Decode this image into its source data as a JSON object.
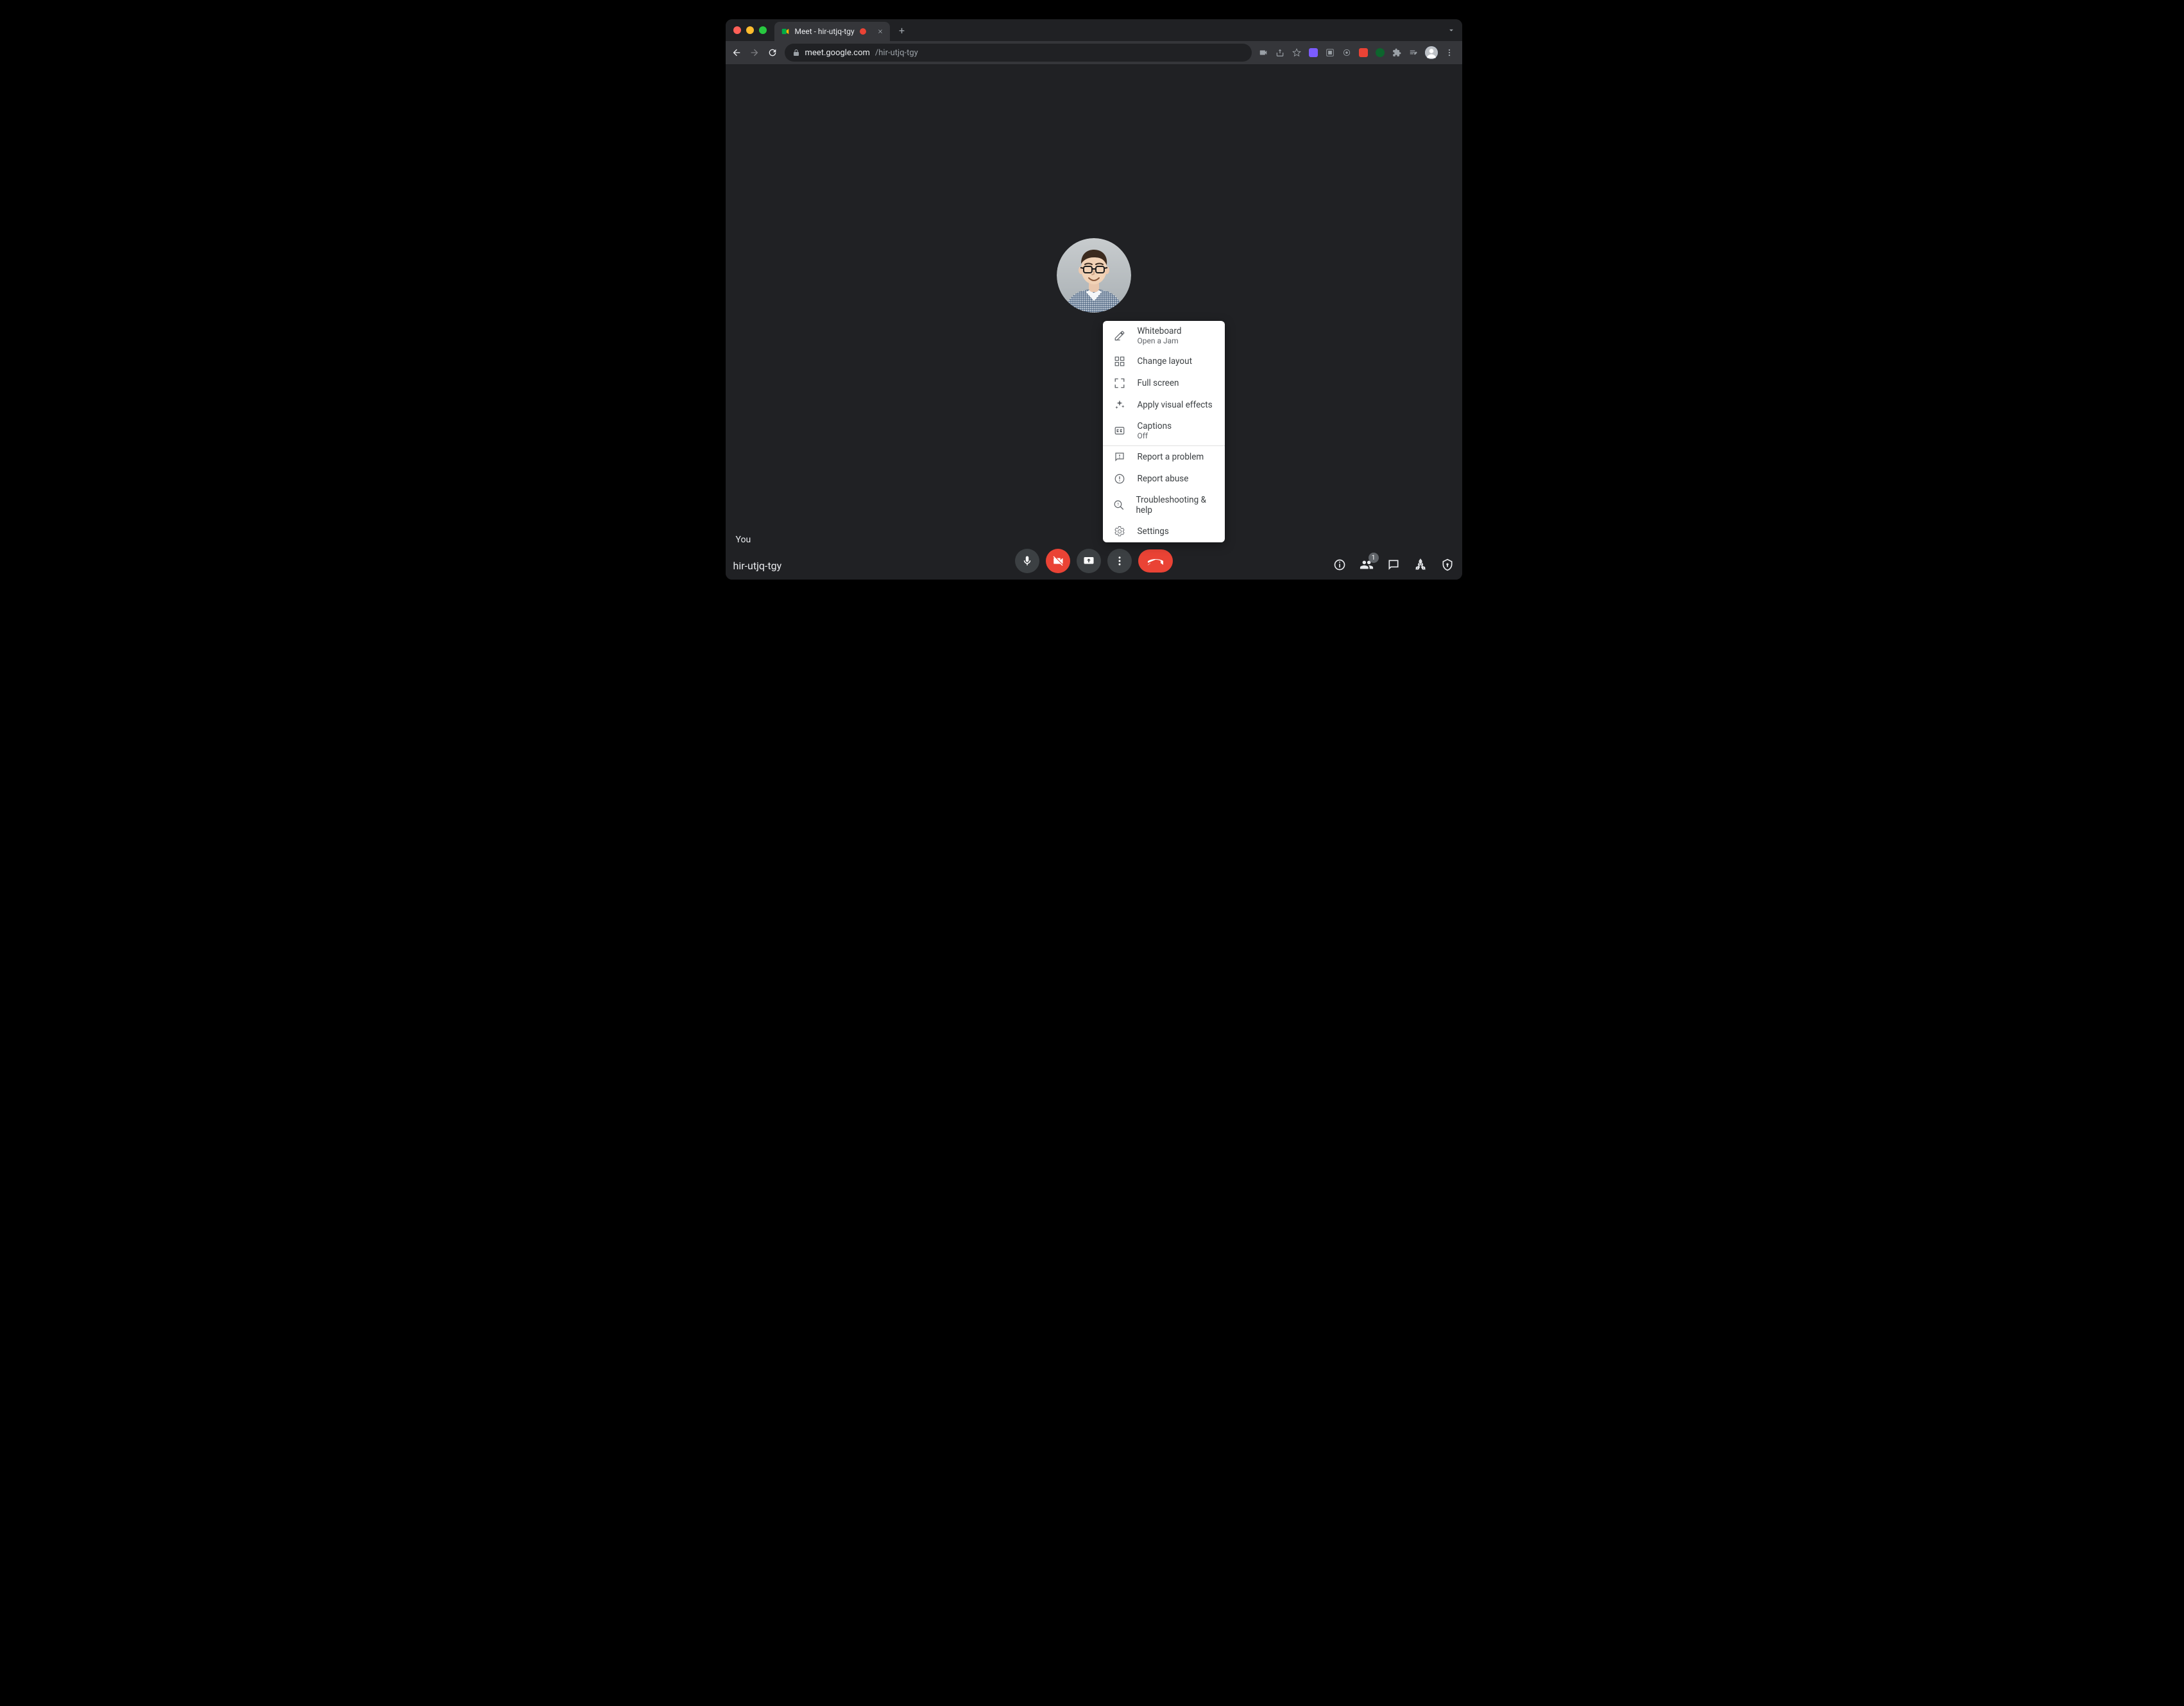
{
  "browser": {
    "tab_title": "Meet - hir-utjq-tgy",
    "url_host": "meet.google.com",
    "url_path": "/hir-utjq-tgy"
  },
  "meet": {
    "you_label": "You",
    "meeting_code": "hir-utjq-tgy",
    "participant_count": "1"
  },
  "menu": {
    "whiteboard": {
      "label": "Whiteboard",
      "sub": "Open a Jam"
    },
    "layout": {
      "label": "Change layout"
    },
    "fullscreen": {
      "label": "Full screen"
    },
    "effects": {
      "label": "Apply visual effects"
    },
    "captions": {
      "label": "Captions",
      "sub": "Off"
    },
    "report_problem": {
      "label": "Report a problem"
    },
    "report_abuse": {
      "label": "Report abuse"
    },
    "troubleshoot": {
      "label": "Troubleshooting & help"
    },
    "settings": {
      "label": "Settings"
    }
  }
}
